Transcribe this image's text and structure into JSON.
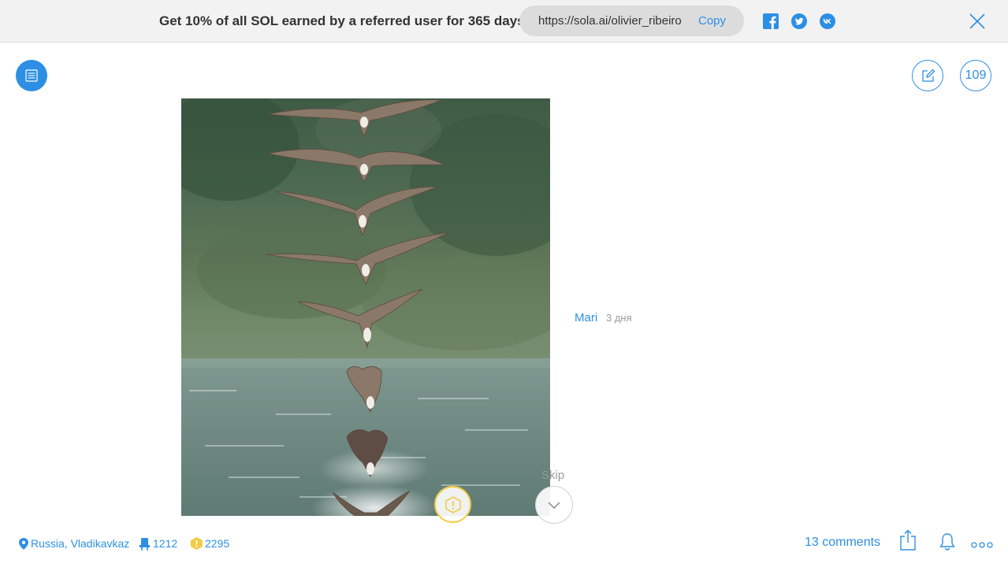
{
  "banner": {
    "text": "Get 10% of all SOL earned by a referred user for 365 days",
    "referral_url": "https://sola.ai/olivier_ribeiro",
    "copy_label": "Copy",
    "social_icons": [
      "facebook-icon",
      "twitter-icon",
      "vk-icon"
    ],
    "close_icon": "close-icon"
  },
  "header": {
    "menu_icon": "list-icon",
    "new_post_icon": "edit-icon",
    "count": "109"
  },
  "post": {
    "image_description_icon": "photo",
    "author": "Mari",
    "time": "3 дня"
  },
  "actions": {
    "skip_label": "Skip",
    "skip_icon": "chevron-down-icon",
    "coin_icon": "sol-coin-icon"
  },
  "stats": {
    "location": "Russia, Vladikavkaz",
    "views": "1212",
    "coins": "2295",
    "comments": "13 comments"
  },
  "colors": {
    "accent": "#2d8fe3",
    "banner_bg": "#f2f2f2",
    "pill_bg": "#dcdcdc",
    "coin": "#f3cc45",
    "muted": "#9a9a9a"
  }
}
